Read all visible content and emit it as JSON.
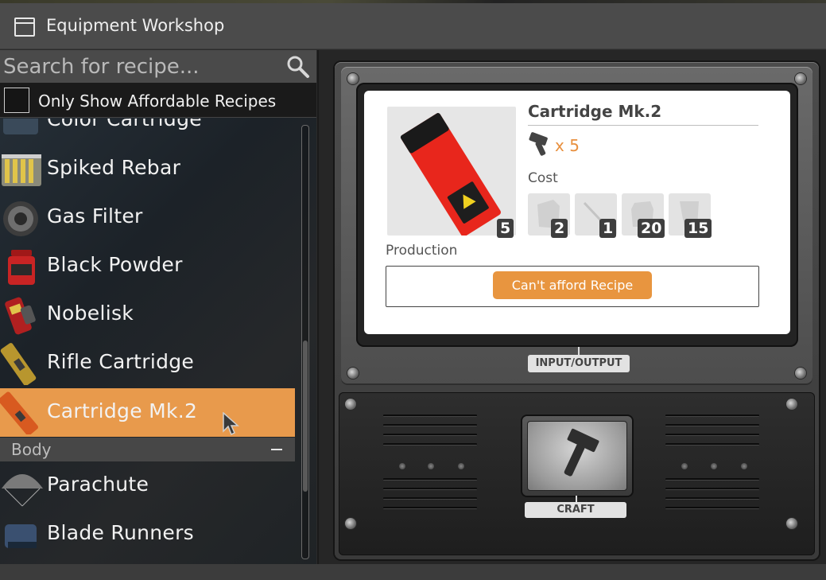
{
  "window": {
    "title": "Equipment Workshop",
    "icon": "window-icon"
  },
  "search": {
    "placeholder": "Search for recipe...",
    "value": "",
    "icon": "search-icon"
  },
  "filter": {
    "label": "Only Show Affordable Recipes",
    "checked": false
  },
  "recipes": [
    {
      "label": "Color Cartridge",
      "icon": "color-cartridge-icon",
      "selected": false
    },
    {
      "label": "Spiked Rebar",
      "icon": "spiked-rebar-icon",
      "selected": false
    },
    {
      "label": "Gas Filter",
      "icon": "gas-filter-icon",
      "selected": false
    },
    {
      "label": "Black Powder",
      "icon": "black-powder-icon",
      "selected": false
    },
    {
      "label": "Nobelisk",
      "icon": "nobelisk-icon",
      "selected": false
    },
    {
      "label": "Rifle Cartridge",
      "icon": "rifle-cartridge-icon",
      "selected": false
    },
    {
      "label": "Cartridge Mk.2",
      "icon": "cartridge-mk2-icon",
      "selected": true
    }
  ],
  "category": {
    "label": "Body",
    "collapse_symbol": "−"
  },
  "body_recipes": [
    {
      "label": "Parachute",
      "icon": "parachute-icon"
    },
    {
      "label": "Blade Runners",
      "icon": "blade-runners-icon"
    }
  ],
  "detail": {
    "name": "Cartridge Mk.2",
    "output_qty": "5",
    "multiplier": "x 5",
    "cost_label": "Cost",
    "costs": [
      {
        "icon": "ingredient-1-icon",
        "qty": "2"
      },
      {
        "icon": "ingredient-2-icon",
        "qty": "1"
      },
      {
        "icon": "ingredient-3-icon",
        "qty": "20"
      },
      {
        "icon": "ingredient-4-icon",
        "qty": "15"
      }
    ],
    "production_label": "Production",
    "production_button": "Can't afford Recipe"
  },
  "machine": {
    "io_label": "INPUT/OUTPUT",
    "craft_label": "CRAFT"
  },
  "colors": {
    "accent": "#e89a4c",
    "button_orange": "#e8953f",
    "multiplier_orange": "#e8903f"
  }
}
